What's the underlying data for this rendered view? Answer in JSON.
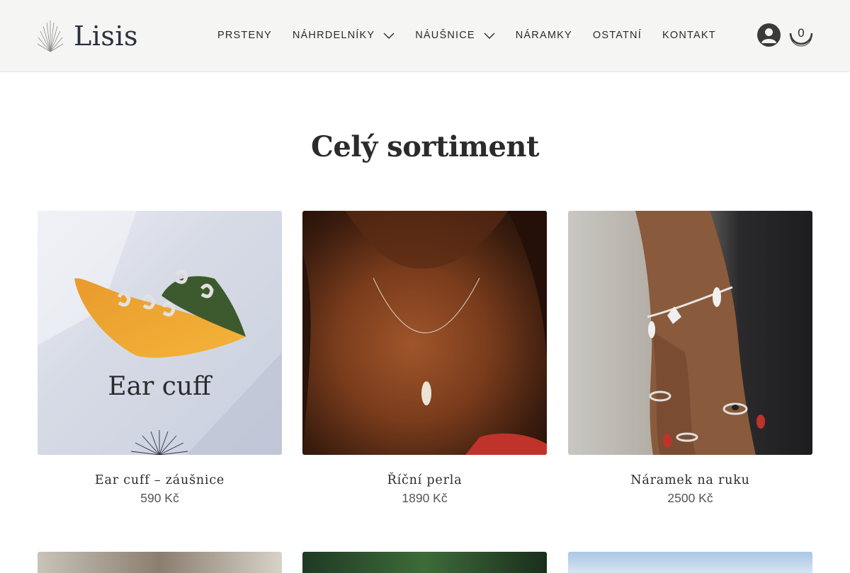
{
  "brand": {
    "name": "Lisis"
  },
  "nav": [
    {
      "label": "PRSTENY",
      "has_dropdown": false
    },
    {
      "label": "NÁHRDELNÍKY",
      "has_dropdown": true
    },
    {
      "label": "NÁUŠNICE",
      "has_dropdown": true
    },
    {
      "label": "NÁRAMKY",
      "has_dropdown": false
    },
    {
      "label": "OSTATNÍ",
      "has_dropdown": false
    },
    {
      "label": "KONTAKT",
      "has_dropdown": false
    }
  ],
  "cart": {
    "count": "0"
  },
  "page": {
    "title": "Celý sortiment"
  },
  "products": [
    {
      "name": "Ear cuff – záušnice",
      "price": "590 Kč",
      "image_caption": "Ear cuff"
    },
    {
      "name": "Říční perla",
      "price": "1890 Kč"
    },
    {
      "name": "Náramek na ruku",
      "price": "2500 Kč"
    }
  ],
  "icons": {
    "user": "user-account-icon",
    "cart": "shopping-bag-icon",
    "dropdown": "chevron-down-icon"
  },
  "colors": {
    "header_bg": "#f5f5f4",
    "brand": "#2d2f42",
    "text": "#2b2b2b"
  }
}
